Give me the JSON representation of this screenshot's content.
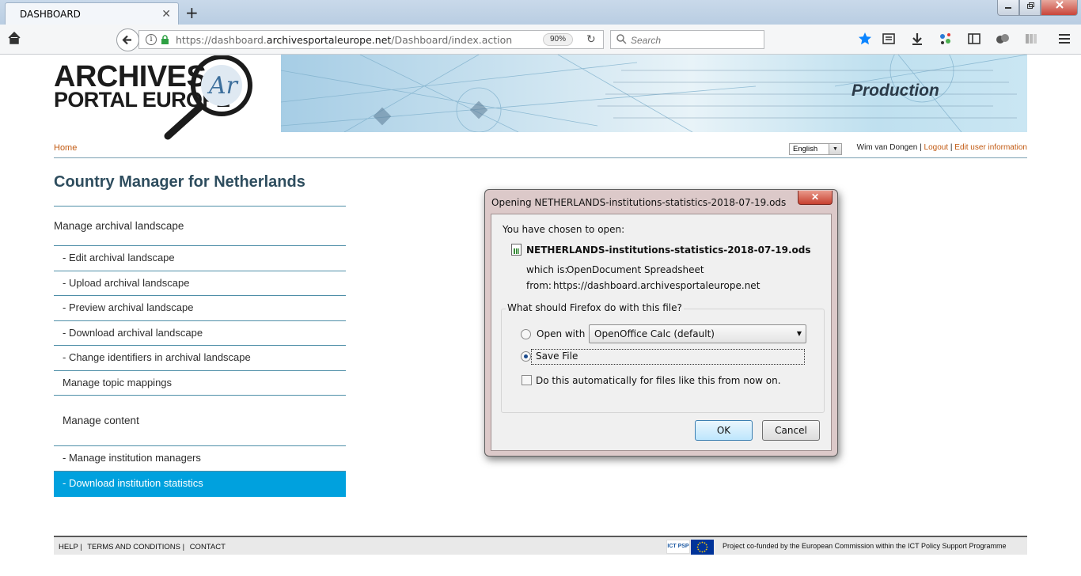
{
  "browser": {
    "tab_title": "DASHBOARD",
    "tab_close": "✕",
    "new_tab": "+",
    "url_prefix": "https://dashboard.",
    "url_host": "archivesportaleurope.net",
    "url_path": "/Dashboard/index.action",
    "zoom": "90%",
    "search_placeholder": "Search",
    "window_controls": [
      "minimize",
      "maximize",
      "close"
    ],
    "toolbar_icons": [
      "bookmark-star-icon",
      "reading-list-icon",
      "download-icon",
      "extension-icon",
      "sidebar-icon",
      "sync-icon",
      "library-icon",
      "menu-icon"
    ]
  },
  "site": {
    "logo_line1": "ARCHIVES",
    "logo_line2": "PORTAL EUROPE",
    "banner_title": "Production",
    "nav": {
      "home": "Home",
      "language": "English",
      "user": "Wim van Dongen",
      "separator": "|",
      "logout": "Logout",
      "edit_user": "Edit user information"
    },
    "page_title": "Country Manager for Netherlands",
    "menu": [
      {
        "label": "Manage archival landscape",
        "kind": "section"
      },
      {
        "label": "- Edit archival landscape",
        "kind": "item"
      },
      {
        "label": "- Upload archival landscape",
        "kind": "item"
      },
      {
        "label": "- Preview archival landscape",
        "kind": "item"
      },
      {
        "label": "- Download archival landscape",
        "kind": "item"
      },
      {
        "label": "- Change identifiers in archival landscape",
        "kind": "item"
      },
      {
        "label": "Manage topic mappings",
        "kind": "item"
      },
      {
        "label": "Manage content",
        "kind": "section-in"
      },
      {
        "label": "- Manage institution managers",
        "kind": "item"
      },
      {
        "label": "- Download institution statistics",
        "kind": "active"
      }
    ],
    "footer": {
      "help": "HELP |",
      "terms": "TERMS AND CONDITIONS |",
      "contact": "CONTACT",
      "ict_logo": "ICT PSP",
      "note": "Project co-funded by the European Commission within the ICT Policy Support Programme"
    }
  },
  "dialog": {
    "title": "Opening NETHERLANDS-institutions-statistics-2018-07-19.ods",
    "close": "✕",
    "chosen_label": "You have chosen to open:",
    "filename": "NETHERLANDS-institutions-statistics-2018-07-19.ods",
    "which_is_label": "which is:",
    "which_is_value": "OpenDocument Spreadsheet",
    "from_label": "from:",
    "from_value": "https://dashboard.archivesportaleurope.net",
    "question": "What should Firefox do with this file?",
    "open_with_label": "Open with",
    "open_with_app": "OpenOffice Calc (default)",
    "save_file_label": "Save File",
    "auto_label": "Do this automatically for files like this from now on.",
    "selected_option": "save",
    "ok": "OK",
    "cancel": "Cancel"
  },
  "colors": {
    "accent_orange": "#c25a12",
    "menu_active": "#00a1de",
    "title_blue": "#2e4d5e"
  }
}
